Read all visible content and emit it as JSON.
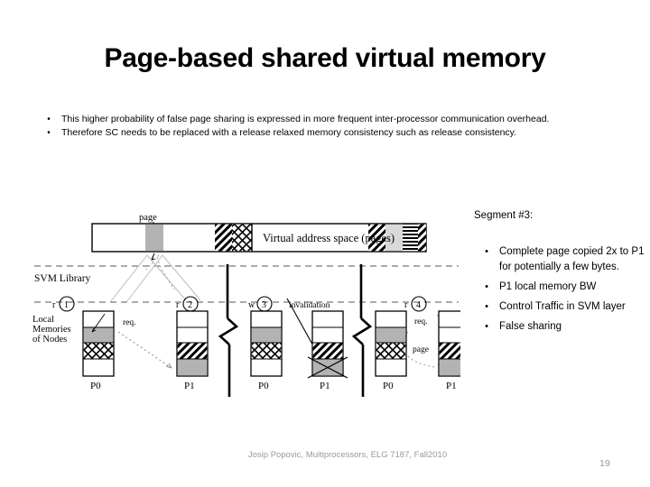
{
  "slide": {
    "title": "Page-based shared virtual memory",
    "bullet_marker": "•"
  },
  "body": {
    "bullets": [
      "This higher probability of false page sharing is expressed in more frequent inter-processor communication overhead.",
      "Therefore SC needs to be replaced with a release relaxed memory consistency such as release consistency."
    ]
  },
  "segment_panel": {
    "heading": "Segment #3:",
    "bullets": [
      "Complete page copied 2x to P1 for potentially a few bytes.",
      "P1 local memory BW",
      "Control Traffic in SVM layer",
      "False sharing"
    ]
  },
  "diagram": {
    "vas_label": "Virtual address space (pages)",
    "page_label": "page",
    "svm_library_label": "SVM Library",
    "local_memories_label": [
      "Local",
      "Memories",
      "of Nodes"
    ],
    "steps": [
      {
        "op": "r",
        "num": "1"
      },
      {
        "op": "r",
        "num": "2"
      },
      {
        "op": "w",
        "num": "3"
      },
      {
        "op": "r",
        "num": "4"
      }
    ],
    "invalidation_label": "invalidation",
    "req_labels": [
      "req.",
      "req.",
      "req."
    ],
    "page_transfer_label": "page",
    "node_labels": [
      "P0",
      "P1",
      "P0",
      "P1",
      "P0",
      "P1"
    ],
    "colors": {
      "gray_fill": "#b3b3b3",
      "light_gray_fill": "#d9d9d9",
      "stroke": "#000000",
      "dashed_guide": "#555555"
    }
  },
  "footer": {
    "credit_line1": "Josip Popovic, Multiprocessors, ELG 7187,",
    "credit_line2": "Fall2010",
    "page_number": "19",
    "color": "#9a9a9a"
  }
}
